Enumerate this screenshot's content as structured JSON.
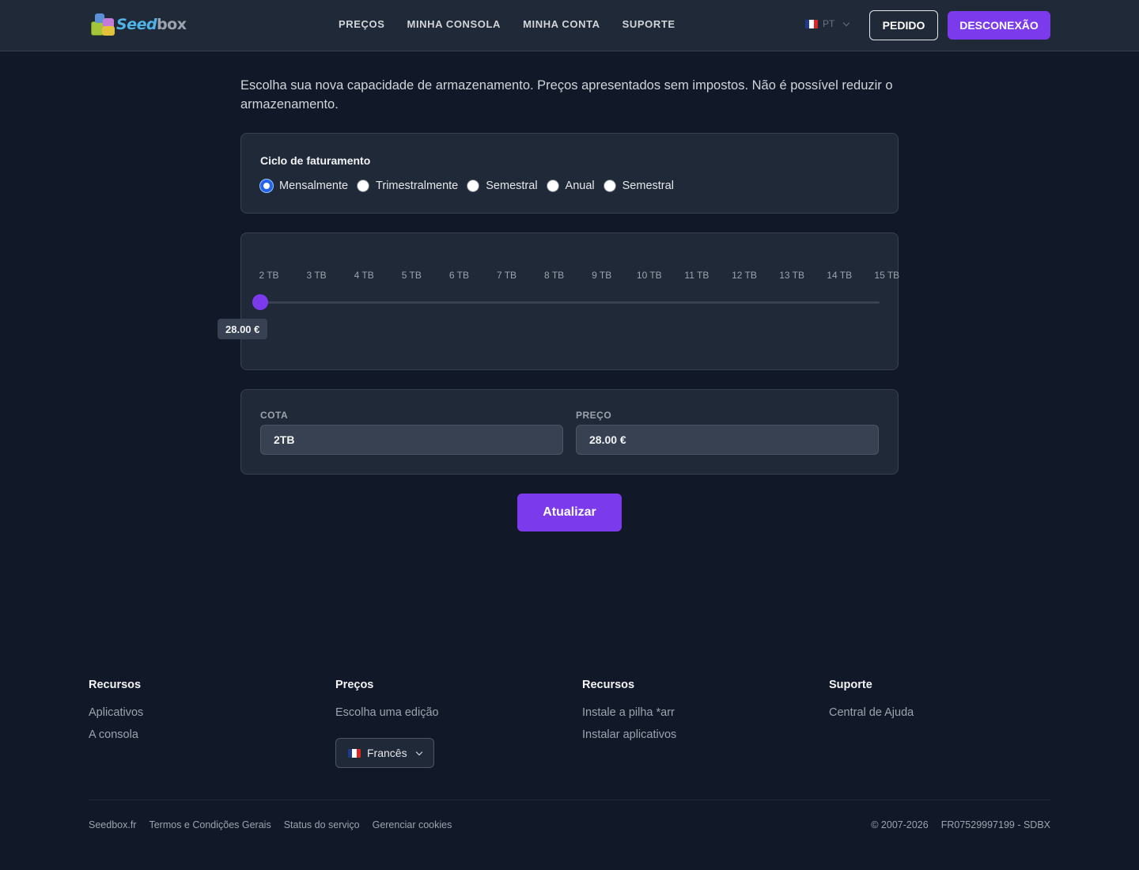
{
  "header": {
    "logo": {
      "seed": "Seed",
      "box": "box"
    },
    "nav": [
      "PREÇOS",
      "MINHA CONSOLA",
      "MINHA CONTA",
      "SUPORTE"
    ],
    "language_code": "PT",
    "order_button": "PEDIDO",
    "logout_button": "DESCONEXÃO"
  },
  "main": {
    "intro": "Escolha sua nova capacidade de armazenamento. Preços apresentados sem impostos. Não é possível reduzir o armazenamento.",
    "billing": {
      "title": "Ciclo de faturamento",
      "options": [
        "Mensalmente",
        "Trimestralmente",
        "Semestral",
        "Anual",
        "Semestral"
      ],
      "selected": "Mensalmente"
    },
    "slider": {
      "ticks": [
        "2 TB",
        "3 TB",
        "4 TB",
        "5 TB",
        "6 TB",
        "7 TB",
        "8 TB",
        "9 TB",
        "10 TB",
        "11 TB",
        "12 TB",
        "13 TB",
        "14 TB",
        "15 TB"
      ],
      "current_value_tb": 2,
      "price_label": "28.00 €"
    },
    "fields": {
      "quota_label": "COTA",
      "quota_value": "2TB",
      "price_label": "PREÇO",
      "price_value": "28.00 €"
    },
    "update_button": "Atualizar"
  },
  "footer": {
    "columns": [
      {
        "title": "Recursos",
        "links": [
          "Aplicativos",
          "A consola"
        ]
      },
      {
        "title": "Preços",
        "links": [
          "Escolha uma edição"
        ]
      },
      {
        "title": "Recursos",
        "links": [
          "Instale a pilha *arr",
          "Instalar aplicativos"
        ]
      },
      {
        "title": "Suporte",
        "links": [
          "Central de Ajuda"
        ]
      }
    ],
    "language_select": "Francês",
    "bottom_links": [
      "Seedbox.fr",
      "Termos e Condições Gerais",
      "Status do serviço",
      "Gerenciar cookies"
    ],
    "copyright": "© 2007-2026",
    "company_id": "FR07529997199 - SDBX"
  },
  "colors": {
    "background": "#111827",
    "header": "#1f2937",
    "accent": "#7c3aed",
    "radio_selected": "#2563eb"
  }
}
